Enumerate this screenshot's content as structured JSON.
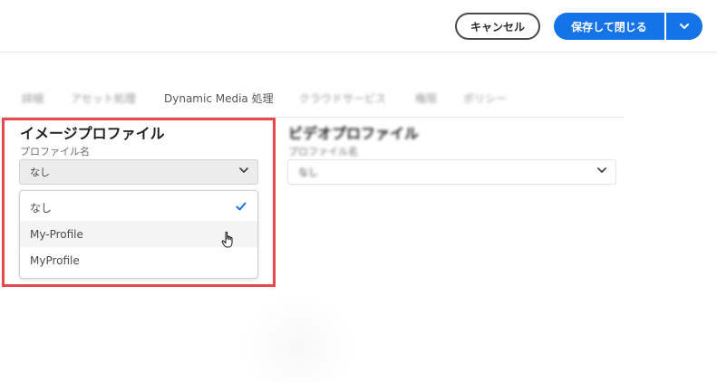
{
  "header": {
    "cancel_label": "キャンセル",
    "save_close_label": "保存して閉じる"
  },
  "tabs": [
    {
      "label": "詳細"
    },
    {
      "label": "アセット処理"
    },
    {
      "label": "Dynamic Media 処理"
    },
    {
      "label": "クラウドサービス"
    },
    {
      "label": "権限"
    },
    {
      "label": "ポリシー"
    }
  ],
  "image_profile": {
    "title": "イメージプロファイル",
    "field_label": "プロファイル名",
    "selected_value": "なし",
    "options": [
      {
        "label": "なし",
        "checked": true
      },
      {
        "label": "My-Profile",
        "checked": false
      },
      {
        "label": "MyProfile",
        "checked": false
      }
    ]
  },
  "video_profile": {
    "title": "ビデオプロファイル",
    "field_label": "プロファイル名",
    "selected_value": "なし"
  },
  "colors": {
    "accent": "#1473e6",
    "highlight_border": "#e8474c"
  },
  "icons": {
    "dropdown": "chevron-down-icon",
    "check": "checkmark-icon",
    "pointer": "hand-pointer-icon"
  }
}
